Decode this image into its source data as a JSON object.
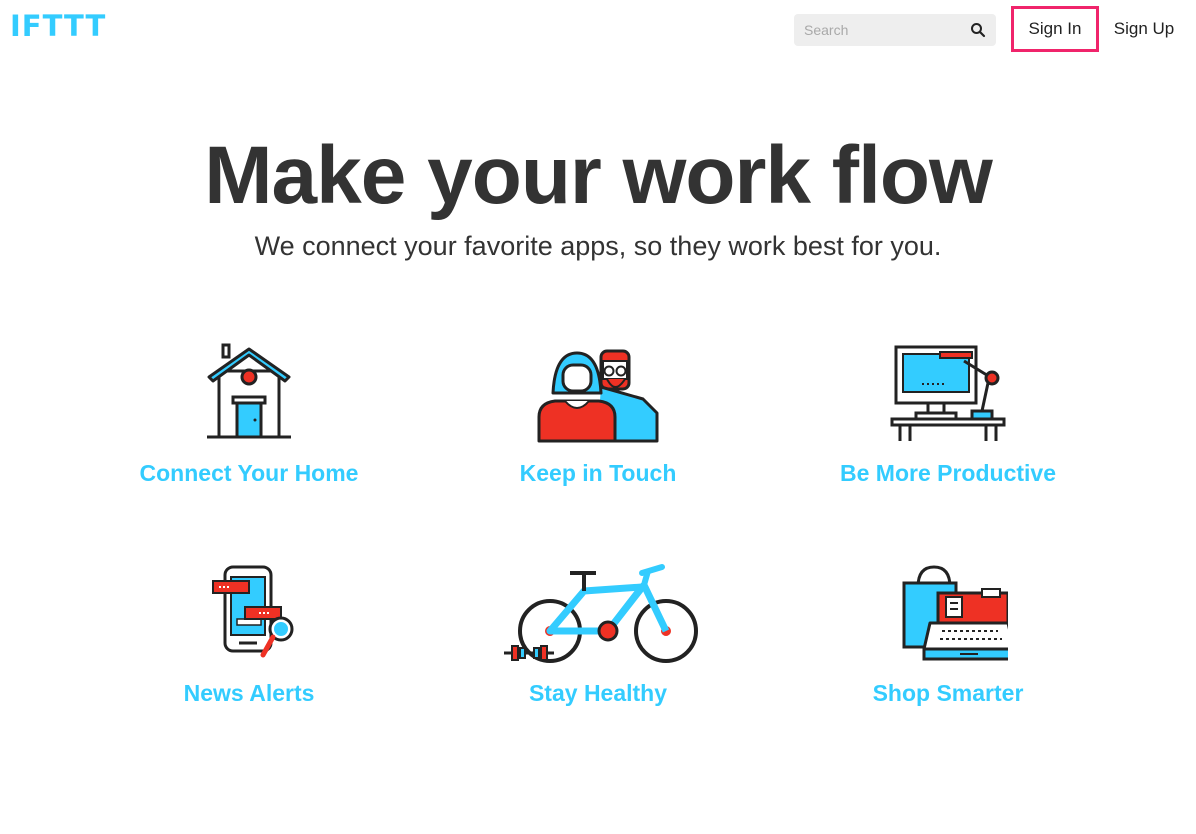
{
  "header": {
    "logo": "IFTTT",
    "search_placeholder": "Search",
    "signin_label": "Sign In",
    "signup_label": "Sign Up"
  },
  "hero": {
    "title": "Make your work flow",
    "subtitle": "We connect your favorite apps, so they work best for you."
  },
  "categories": [
    {
      "label": "Connect Your Home",
      "icon": "house-icon"
    },
    {
      "label": "Keep in Touch",
      "icon": "people-icon"
    },
    {
      "label": "Be More Productive",
      "icon": "desk-computer-icon"
    },
    {
      "label": "News Alerts",
      "icon": "phone-news-icon"
    },
    {
      "label": "Stay Healthy",
      "icon": "bicycle-icon"
    },
    {
      "label": "Shop Smarter",
      "icon": "shopping-register-icon"
    }
  ],
  "colors": {
    "brand_blue": "#33ccff",
    "signin_highlight": "#f0246b",
    "illustration_red": "#ee3124",
    "text_dark": "#333333"
  }
}
